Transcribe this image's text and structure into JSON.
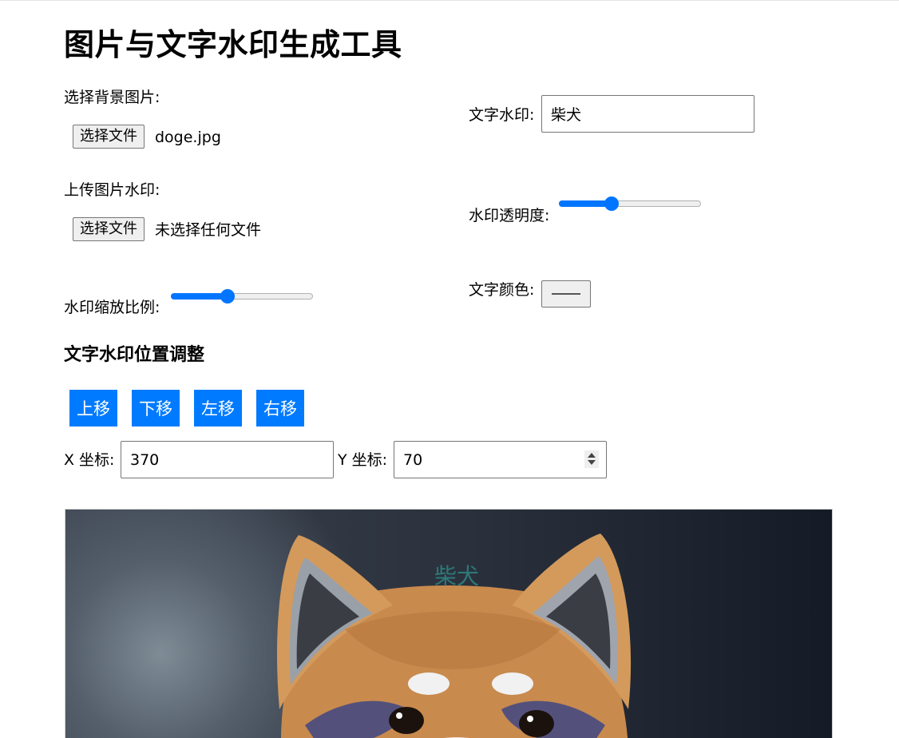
{
  "page": {
    "title": "图片与文字水印生成工具"
  },
  "background_image": {
    "label": "选择背景图片:",
    "button_label": "选择文件",
    "file_name": "doge.jpg"
  },
  "image_watermark": {
    "label": "上传图片水印:",
    "button_label": "选择文件",
    "file_name": "未选择任何文件"
  },
  "watermark_scale": {
    "label": "水印缩放比例:",
    "value_fraction": 0.4
  },
  "text_watermark": {
    "label": "文字水印:",
    "value": "柴犬"
  },
  "watermark_opacity": {
    "label": "水印透明度:",
    "value_fraction": 0.37
  },
  "text_color": {
    "label": "文字颜色:",
    "value": "#555555"
  },
  "position_section": {
    "title": "文字水印位置调整",
    "buttons": {
      "up": "上移",
      "down": "下移",
      "left": "左移",
      "right": "右移"
    },
    "x_label": "X 坐标:",
    "x_value": "370",
    "y_label": "Y 坐标:",
    "y_value": "70"
  },
  "preview": {
    "watermark_text": "柴犬"
  },
  "colors": {
    "accent": "#0075ff",
    "button_blue": "#007bff",
    "watermark_text": "#2f8a86"
  }
}
